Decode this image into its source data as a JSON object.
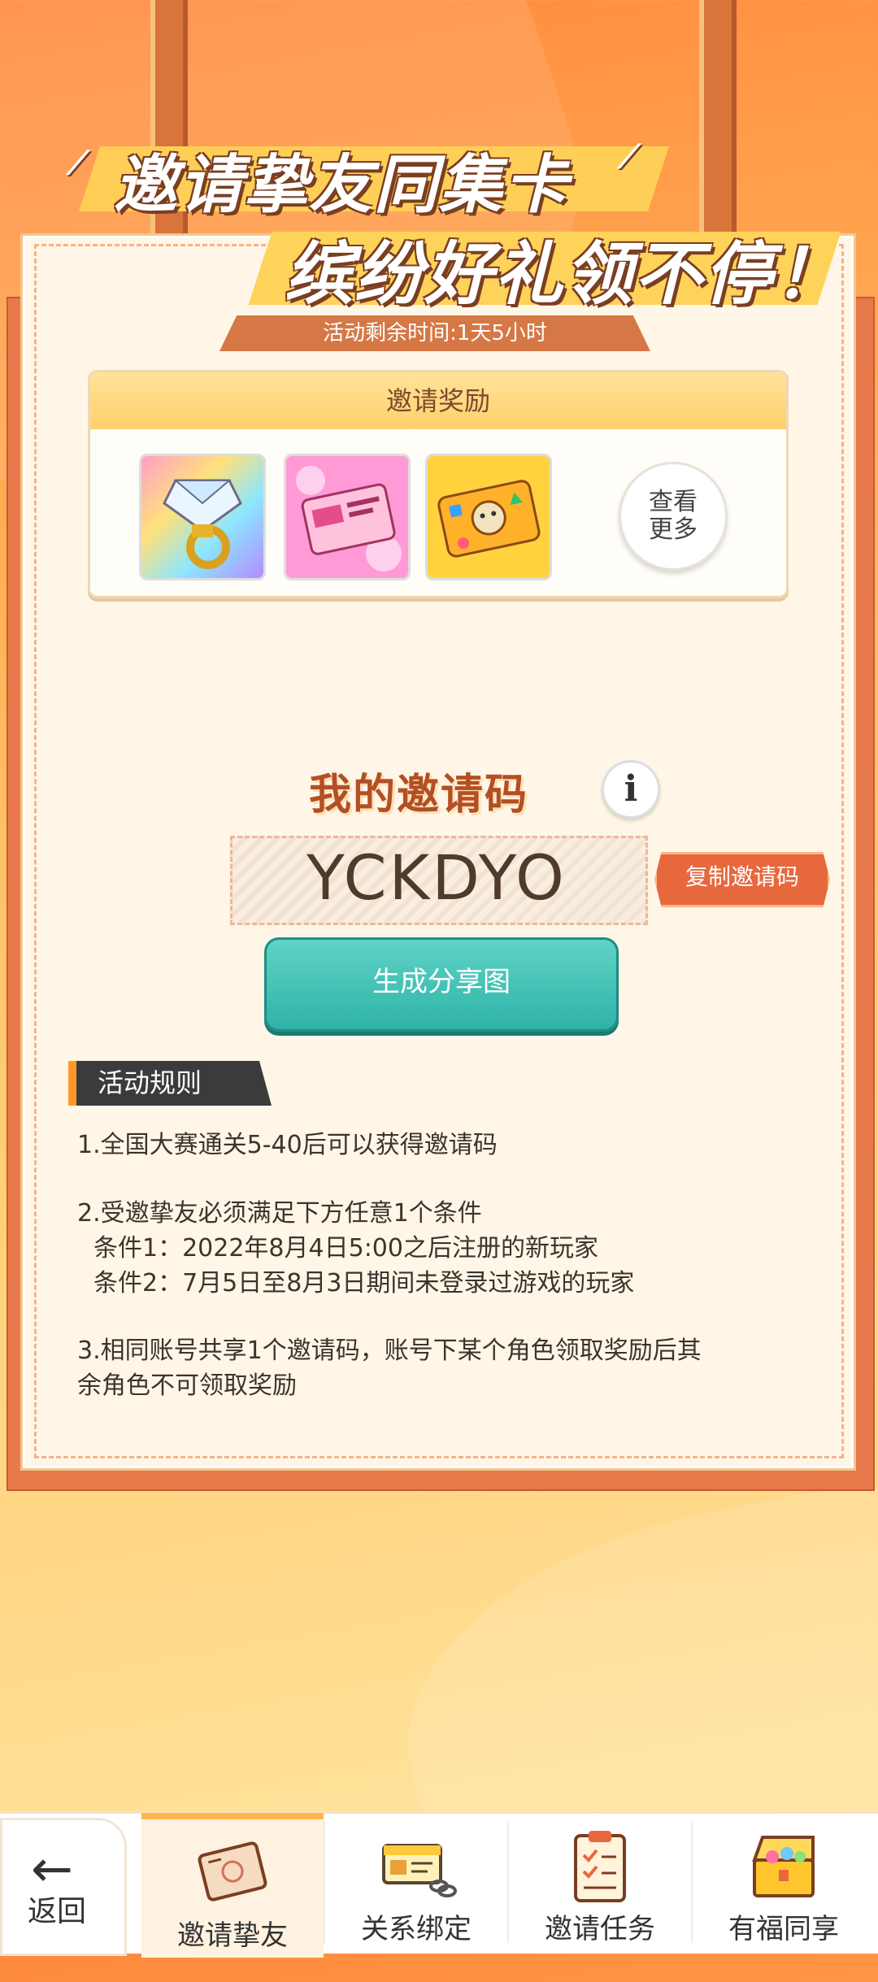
{
  "headline": {
    "line1": "邀请挚友同集卡",
    "line2": "缤纷好礼领不停！"
  },
  "timer": "活动剩余时间:1天5小时",
  "rewards": {
    "title": "邀请奖励",
    "items": [
      {
        "icon": "diamond-ring-icon"
      },
      {
        "icon": "pink-card-icon"
      },
      {
        "icon": "gold-card-icon"
      }
    ],
    "more_label": "查看更多"
  },
  "invite": {
    "title": "我的邀请码",
    "info_icon": "i",
    "code": "YCKDYO",
    "copy_label": "复制邀请码",
    "share_label": "生成分享图"
  },
  "rules": {
    "title": "活动规则",
    "lines": [
      "1.全国大赛通关5-40后可以获得邀请码",
      "2.受邀挚友必须满足下方任意1个条件",
      "  条件1：2022年8月4日5:00之后注册的新玩家",
      "  条件2：7月5日至8月3日期间未登录过游戏的玩家",
      "3.相同账号共享1个邀请码，账号下某个角色领取奖励后其",
      "余角色不可领取奖励"
    ]
  },
  "nav": {
    "back": {
      "arrow": "←",
      "label": "返回"
    },
    "tabs": [
      {
        "label": "邀请挚友",
        "icon": "invite-letter-icon",
        "active": true
      },
      {
        "label": "关系绑定",
        "icon": "id-card-link-icon",
        "active": false
      },
      {
        "label": "邀请任务",
        "icon": "clipboard-checklist-icon",
        "active": false
      },
      {
        "label": "有福同享",
        "icon": "treasure-chest-icon",
        "active": false
      }
    ]
  },
  "colors": {
    "accent_orange": "#e8683d",
    "share_teal": "#2fb3a7",
    "panel_bg": "#fff6e8"
  }
}
